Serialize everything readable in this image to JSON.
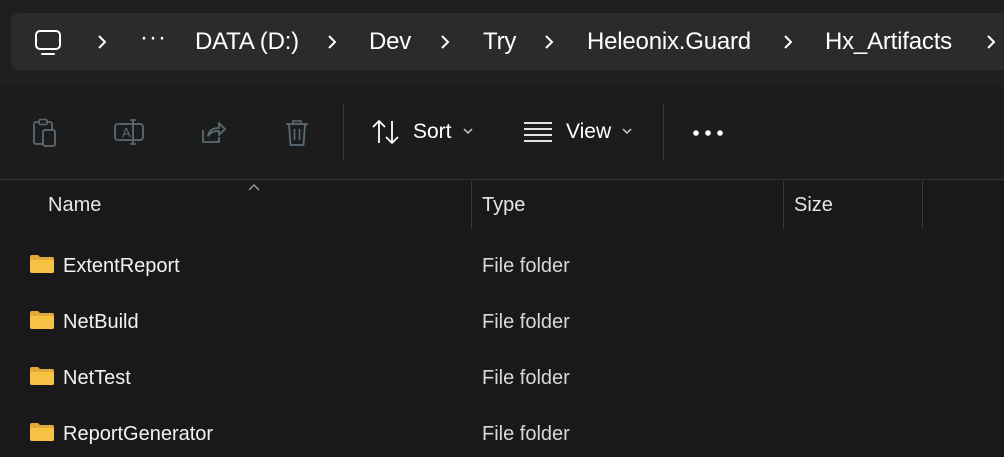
{
  "breadcrumb": {
    "items": [
      "DATA (D:)",
      "Dev",
      "Try",
      "Heleonix.Guard",
      "Hx_Artifacts"
    ]
  },
  "toolbar": {
    "sort_label": "Sort",
    "view_label": "View"
  },
  "columns": {
    "name": "Name",
    "type": "Type",
    "size": "Size"
  },
  "files": [
    {
      "name": "ExtentReport",
      "type": "File folder"
    },
    {
      "name": "NetBuild",
      "type": "File folder"
    },
    {
      "name": "NetTest",
      "type": "File folder"
    },
    {
      "name": "ReportGenerator",
      "type": "File folder"
    }
  ],
  "colors": {
    "folder": "#f6c344",
    "background": "#191919",
    "toolbar": "#1c1c1c",
    "address_bar": "#2b2b2b"
  }
}
